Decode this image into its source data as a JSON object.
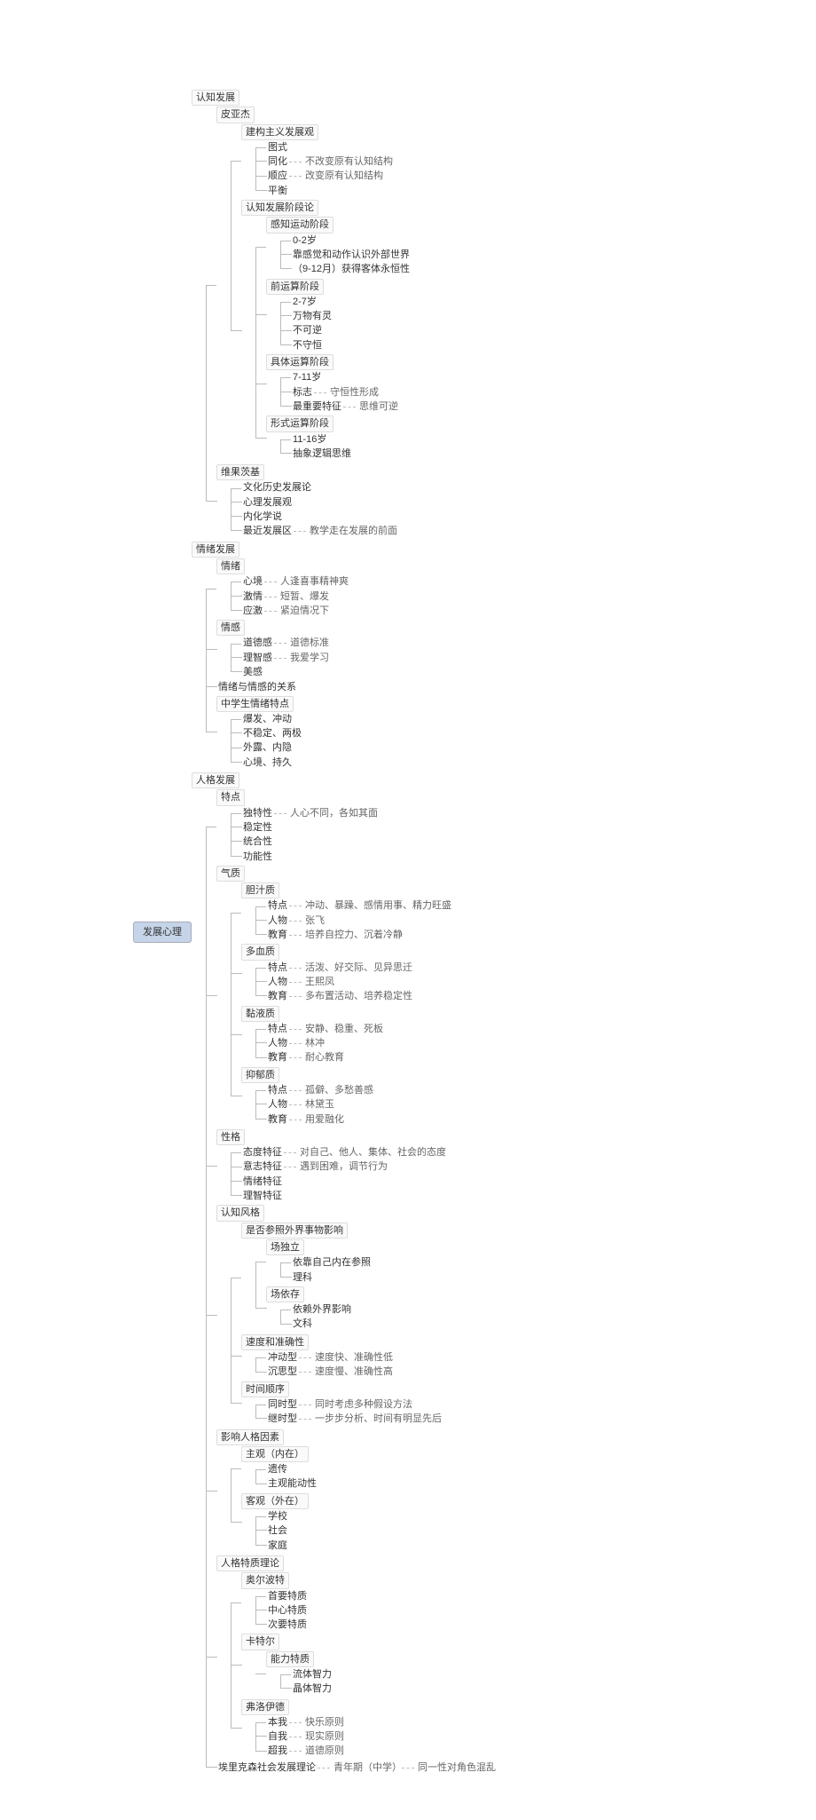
{
  "root": "发展心理",
  "n": {
    "cog": "认知发展",
    "piaget": "皮亚杰",
    "constr": "建构主义发展观",
    "schema": "图式",
    "assim": "同化",
    "assim_n": "不改变原有认知结构",
    "accom": "顺应",
    "accom_n": "改变原有认知结构",
    "equil": "平衡",
    "stages": "认知发展阶段论",
    "s1": "感知运动阶段",
    "s1a": "0-2岁",
    "s1b": "靠感觉和动作认识外部世界",
    "s1c": "（9-12月）获得客体永恒性",
    "s2": "前运算阶段",
    "s2a": "2-7岁",
    "s2b": "万物有灵",
    "s2c": "不可逆",
    "s2d": "不守恒",
    "s3": "具体运算阶段",
    "s3a": "7-11岁",
    "s3b": "标志",
    "s3b_n": "守恒性形成",
    "s3c": "最重要特征",
    "s3c_n": "思维可逆",
    "s4": "形式运算阶段",
    "s4a": "11-16岁",
    "s4b": "抽象逻辑思维",
    "vyg": "维果茨基",
    "v1": "文化历史发展论",
    "v2": "心理发展观",
    "v3": "内化学说",
    "v4": "最近发展区",
    "v4_n": "教学走在发展的前面",
    "emo": "情绪发展",
    "mood": "情绪",
    "m1": "心境",
    "m1_n": "人逢喜事精神爽",
    "m2": "激情",
    "m2_n": "短暂、爆发",
    "m3": "应激",
    "m3_n": "紧迫情况下",
    "feel": "情感",
    "f1": "道德感",
    "f1_n": "道德标准",
    "f2": "理智感",
    "f2_n": "我爱学习",
    "f3": "美感",
    "rel": "情绪与情感的关系",
    "mschar": "中学生情绪特点",
    "mc1": "爆发、冲动",
    "mc2": "不稳定、两极",
    "mc3": "外露、内隐",
    "mc4": "心境、持久",
    "pers": "人格发展",
    "trait": "特点",
    "t1": "独特性",
    "t1_n": "人心不同，各如其面",
    "t2": "稳定性",
    "t3": "统合性",
    "t4": "功能性",
    "temp": "气质",
    "q1": "胆汁质",
    "q1a": "特点",
    "q1a_n": "冲动、暴躁、感情用事、精力旺盛",
    "q1b": "人物",
    "q1b_n": "张飞",
    "q1c": "教育",
    "q1c_n": "培养自控力、沉着冷静",
    "q2": "多血质",
    "q2a": "特点",
    "q2a_n": "活泼、好交际、见异思迁",
    "q2b": "人物",
    "q2b_n": "王熙凤",
    "q2c": "教育",
    "q2c_n": "多布置活动、培养稳定性",
    "q3": "黏液质",
    "q3a": "特点",
    "q3a_n": "安静、稳重、死板",
    "q3b": "人物",
    "q3b_n": "林冲",
    "q3c": "教育",
    "q3c_n": "耐心教育",
    "q4": "抑郁质",
    "q4a": "特点",
    "q4a_n": "孤僻、多愁善感",
    "q4b": "人物",
    "q4b_n": "林黛玉",
    "q4c": "教育",
    "q4c_n": "用爱融化",
    "char": "性格",
    "c1": "态度特征",
    "c1_n": "对自己、他人、集体、社会的态度",
    "c2": "意志特征",
    "c2_n": "遇到困难，调节行为",
    "c3": "情绪特征",
    "c4": "理智特征",
    "cogst": "认知风格",
    "cs1": "是否参照外界事物影响",
    "cs1a": "场独立",
    "cs1a1": "依靠自己内在参照",
    "cs1a2": "理科",
    "cs1b": "场依存",
    "cs1b1": "依赖外界影响",
    "cs1b2": "文科",
    "cs2": "速度和准确性",
    "cs2a": "冲动型",
    "cs2a_n": "速度快、准确性低",
    "cs2b": "沉思型",
    "cs2b_n": "速度慢、准确性高",
    "cs3": "时间顺序",
    "cs3a": "同时型",
    "cs3a_n": "同时考虑多种假设方法",
    "cs3b": "继时型",
    "cs3b_n": "一步步分析、时间有明显先后",
    "infl": "影响人格因素",
    "i1": "主观（内在）",
    "i1a": "遗传",
    "i1b": "主观能动性",
    "i2": "客观（外在）",
    "i2a": "学校",
    "i2b": "社会",
    "i2c": "家庭",
    "theory": "人格特质理论",
    "allport": "奥尔波特",
    "ap1": "首要特质",
    "ap2": "中心特质",
    "ap3": "次要特质",
    "cattell": "卡特尔",
    "cat1": "能力特质",
    "cat1a": "流体智力",
    "cat1b": "晶体智力",
    "freud": "弗洛伊德",
    "fr1": "本我",
    "fr1_n": "快乐原则",
    "fr2": "自我",
    "fr2_n": "现实原则",
    "fr3": "超我",
    "fr3_n": "道德原则",
    "erikson": "埃里克森社会发展理论",
    "er1": "青年期（中学）",
    "er1_n": "同一性对角色混乱"
  }
}
